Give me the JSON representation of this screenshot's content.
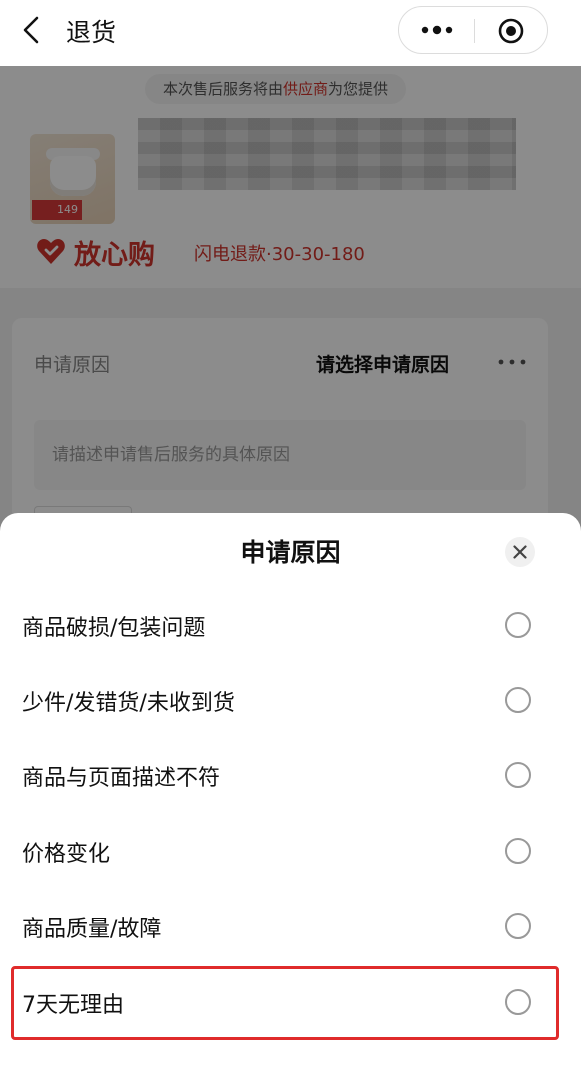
{
  "nav": {
    "title": "退货",
    "icons": [
      "back-arrow-icon",
      "more-dots-icon",
      "target-icon"
    ]
  },
  "product": {
    "notice_prefix": "本次售后服务将由",
    "notice_highlight": "供应商",
    "notice_suffix": "为您提供",
    "price_tag": "149",
    "brand_name": "放心购",
    "brand_sub": "闪电退款·30-30-180"
  },
  "form": {
    "reason_label": "申请原因",
    "reason_value": "请选择申请原因",
    "desc_placeholder": "请描述申请售后服务的具体原因"
  },
  "sheet": {
    "title": "申请原因",
    "options": [
      "商品破损/包装问题",
      "少件/发错货/未收到货",
      "商品与页面描述不符",
      "价格变化",
      "商品质量/故障",
      "7天无理由"
    ],
    "highlighted_option": "7天无理由"
  },
  "colors": {
    "accent_red": "#d0342c",
    "highlight_border": "#e02b2b"
  }
}
